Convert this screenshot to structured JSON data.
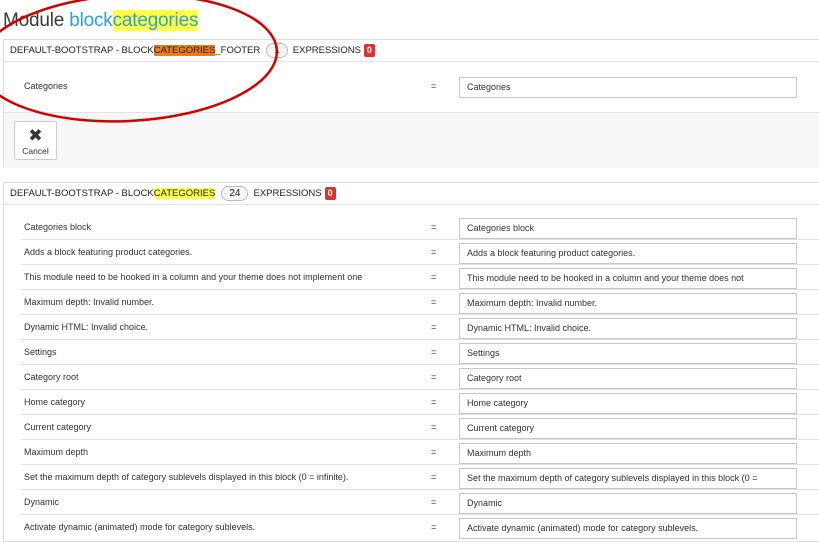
{
  "title": {
    "prefix": "Module",
    "name_plain": "block",
    "name_highlight": "categories"
  },
  "panels": [
    {
      "header": {
        "theme_module": "DEFAULT-BOOTSTRAP - BLOCK",
        "highlight": "CATEGORIES",
        "suffix": "_FOOTER",
        "count": "1",
        "expressions_label": "EXPRESSIONS",
        "missing": "0"
      },
      "rows": [
        {
          "label": "Categories",
          "eq": "=",
          "value": "Categories"
        }
      ],
      "cancel_label": "Cancel"
    },
    {
      "header": {
        "theme_module": "DEFAULT-BOOTSTRAP - BLOCK",
        "highlight": "CATEGORIES",
        "count": "24",
        "expressions_label": "EXPRESSIONS",
        "missing": "0"
      },
      "rows": [
        {
          "label": "Categories block",
          "eq": "=",
          "value": "Categories block"
        },
        {
          "label": "Adds a block featuring product categories.",
          "eq": "=",
          "value": "Adds a block featuring product categories."
        },
        {
          "label": "This module need to be hooked in a column and your theme does not implement one",
          "eq": "=",
          "value": "This module need to be hooked in a column and your theme does not"
        },
        {
          "label": "Maximum depth: Invalid number.",
          "eq": "=",
          "value": "Maximum depth: Invalid number."
        },
        {
          "label": "Dynamic HTML: Invalid choice.",
          "eq": "=",
          "value": "Dynamic HTML: Invalid choice."
        },
        {
          "label": "Settings",
          "eq": "=",
          "value": "Settings"
        },
        {
          "label": "Category root",
          "eq": "=",
          "value": "Category root"
        },
        {
          "label": "Home category",
          "eq": "=",
          "value": "Home category"
        },
        {
          "label": "Current category",
          "eq": "=",
          "value": "Current category"
        },
        {
          "label": "Maximum depth",
          "eq": "=",
          "value": "Maximum depth"
        },
        {
          "label": "Set the maximum depth of category sublevels displayed in this block (0 = infinite).",
          "eq": "=",
          "value": "Set the maximum depth of category sublevels displayed in this block (0 ="
        },
        {
          "label": "Dynamic",
          "eq": "=",
          "value": "Dynamic"
        },
        {
          "label": "Activate dynamic (animated) mode for category sublevels.",
          "eq": "=",
          "value": "Activate dynamic (animated) mode for category sublevels."
        }
      ]
    }
  ],
  "colors": {
    "module_name": "#2ea0d8",
    "highlight_yellow": "#ffff44",
    "highlight_orange": "#ee7a1f",
    "badge_red": "#e0322d",
    "annotation_oval": "#d40000"
  },
  "icons": {
    "cancel": "close-icon"
  }
}
